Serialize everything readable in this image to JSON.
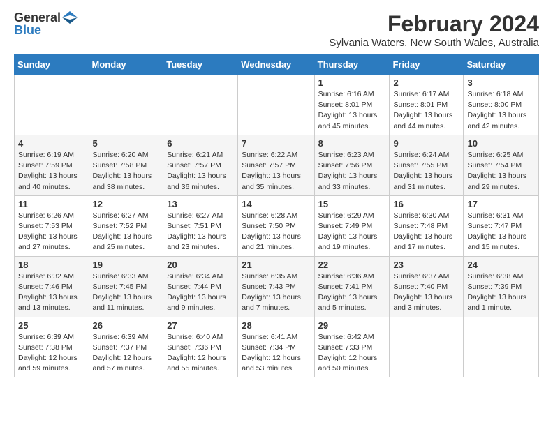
{
  "logo": {
    "general": "General",
    "blue": "Blue"
  },
  "title": "February 2024",
  "location": "Sylvania Waters, New South Wales, Australia",
  "days_of_week": [
    "Sunday",
    "Monday",
    "Tuesday",
    "Wednesday",
    "Thursday",
    "Friday",
    "Saturday"
  ],
  "weeks": [
    [
      {
        "day": "",
        "detail": ""
      },
      {
        "day": "",
        "detail": ""
      },
      {
        "day": "",
        "detail": ""
      },
      {
        "day": "",
        "detail": ""
      },
      {
        "day": "1",
        "detail": "Sunrise: 6:16 AM\nSunset: 8:01 PM\nDaylight: 13 hours\nand 45 minutes."
      },
      {
        "day": "2",
        "detail": "Sunrise: 6:17 AM\nSunset: 8:01 PM\nDaylight: 13 hours\nand 44 minutes."
      },
      {
        "day": "3",
        "detail": "Sunrise: 6:18 AM\nSunset: 8:00 PM\nDaylight: 13 hours\nand 42 minutes."
      }
    ],
    [
      {
        "day": "4",
        "detail": "Sunrise: 6:19 AM\nSunset: 7:59 PM\nDaylight: 13 hours\nand 40 minutes."
      },
      {
        "day": "5",
        "detail": "Sunrise: 6:20 AM\nSunset: 7:58 PM\nDaylight: 13 hours\nand 38 minutes."
      },
      {
        "day": "6",
        "detail": "Sunrise: 6:21 AM\nSunset: 7:57 PM\nDaylight: 13 hours\nand 36 minutes."
      },
      {
        "day": "7",
        "detail": "Sunrise: 6:22 AM\nSunset: 7:57 PM\nDaylight: 13 hours\nand 35 minutes."
      },
      {
        "day": "8",
        "detail": "Sunrise: 6:23 AM\nSunset: 7:56 PM\nDaylight: 13 hours\nand 33 minutes."
      },
      {
        "day": "9",
        "detail": "Sunrise: 6:24 AM\nSunset: 7:55 PM\nDaylight: 13 hours\nand 31 minutes."
      },
      {
        "day": "10",
        "detail": "Sunrise: 6:25 AM\nSunset: 7:54 PM\nDaylight: 13 hours\nand 29 minutes."
      }
    ],
    [
      {
        "day": "11",
        "detail": "Sunrise: 6:26 AM\nSunset: 7:53 PM\nDaylight: 13 hours\nand 27 minutes."
      },
      {
        "day": "12",
        "detail": "Sunrise: 6:27 AM\nSunset: 7:52 PM\nDaylight: 13 hours\nand 25 minutes."
      },
      {
        "day": "13",
        "detail": "Sunrise: 6:27 AM\nSunset: 7:51 PM\nDaylight: 13 hours\nand 23 minutes."
      },
      {
        "day": "14",
        "detail": "Sunrise: 6:28 AM\nSunset: 7:50 PM\nDaylight: 13 hours\nand 21 minutes."
      },
      {
        "day": "15",
        "detail": "Sunrise: 6:29 AM\nSunset: 7:49 PM\nDaylight: 13 hours\nand 19 minutes."
      },
      {
        "day": "16",
        "detail": "Sunrise: 6:30 AM\nSunset: 7:48 PM\nDaylight: 13 hours\nand 17 minutes."
      },
      {
        "day": "17",
        "detail": "Sunrise: 6:31 AM\nSunset: 7:47 PM\nDaylight: 13 hours\nand 15 minutes."
      }
    ],
    [
      {
        "day": "18",
        "detail": "Sunrise: 6:32 AM\nSunset: 7:46 PM\nDaylight: 13 hours\nand 13 minutes."
      },
      {
        "day": "19",
        "detail": "Sunrise: 6:33 AM\nSunset: 7:45 PM\nDaylight: 13 hours\nand 11 minutes."
      },
      {
        "day": "20",
        "detail": "Sunrise: 6:34 AM\nSunset: 7:44 PM\nDaylight: 13 hours\nand 9 minutes."
      },
      {
        "day": "21",
        "detail": "Sunrise: 6:35 AM\nSunset: 7:43 PM\nDaylight: 13 hours\nand 7 minutes."
      },
      {
        "day": "22",
        "detail": "Sunrise: 6:36 AM\nSunset: 7:41 PM\nDaylight: 13 hours\nand 5 minutes."
      },
      {
        "day": "23",
        "detail": "Sunrise: 6:37 AM\nSunset: 7:40 PM\nDaylight: 13 hours\nand 3 minutes."
      },
      {
        "day": "24",
        "detail": "Sunrise: 6:38 AM\nSunset: 7:39 PM\nDaylight: 13 hours\nand 1 minute."
      }
    ],
    [
      {
        "day": "25",
        "detail": "Sunrise: 6:39 AM\nSunset: 7:38 PM\nDaylight: 12 hours\nand 59 minutes."
      },
      {
        "day": "26",
        "detail": "Sunrise: 6:39 AM\nSunset: 7:37 PM\nDaylight: 12 hours\nand 57 minutes."
      },
      {
        "day": "27",
        "detail": "Sunrise: 6:40 AM\nSunset: 7:36 PM\nDaylight: 12 hours\nand 55 minutes."
      },
      {
        "day": "28",
        "detail": "Sunrise: 6:41 AM\nSunset: 7:34 PM\nDaylight: 12 hours\nand 53 minutes."
      },
      {
        "day": "29",
        "detail": "Sunrise: 6:42 AM\nSunset: 7:33 PM\nDaylight: 12 hours\nand 50 minutes."
      },
      {
        "day": "",
        "detail": ""
      },
      {
        "day": "",
        "detail": ""
      }
    ]
  ]
}
